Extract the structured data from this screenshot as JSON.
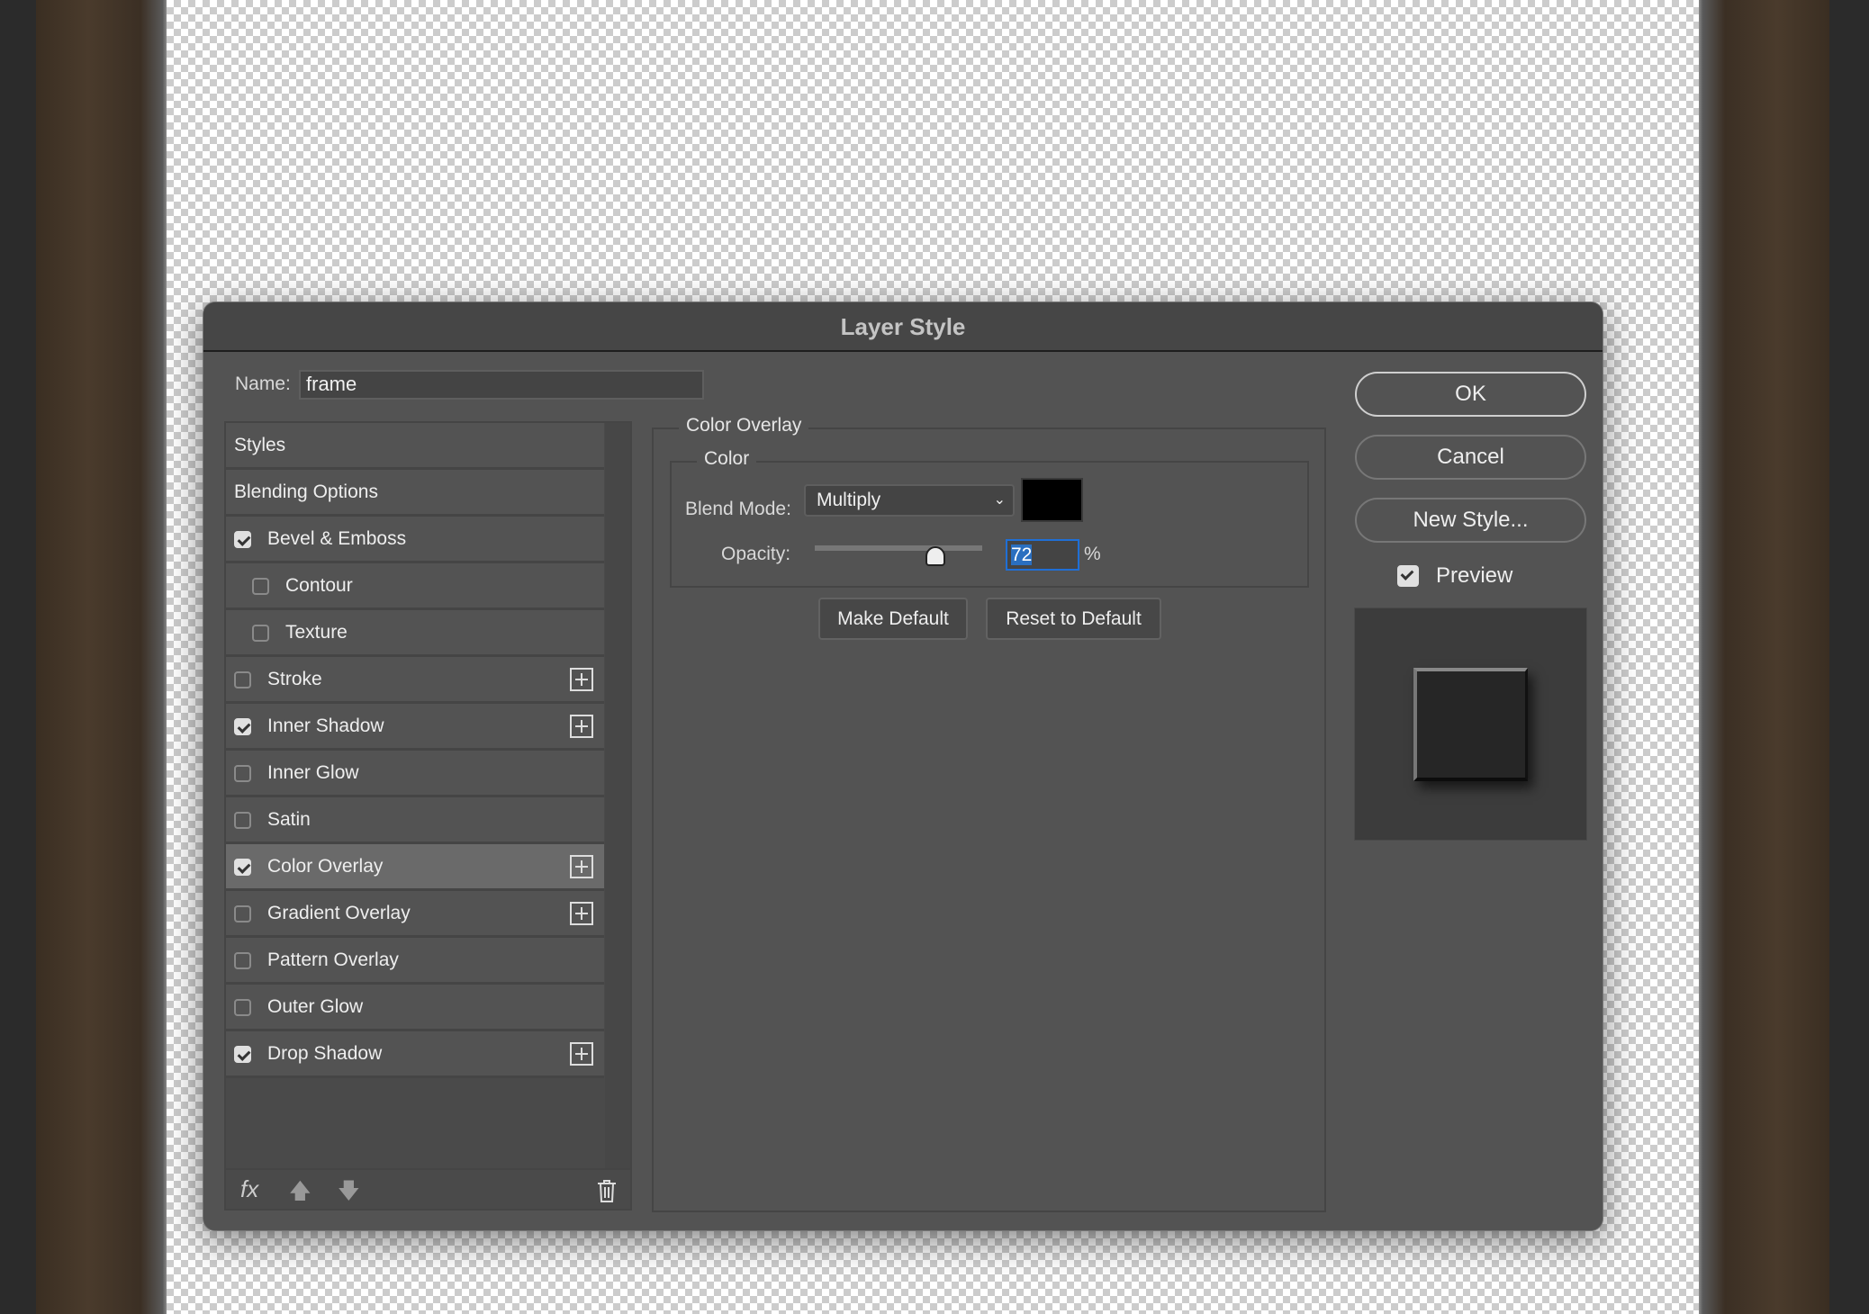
{
  "dialog": {
    "title": "Layer Style"
  },
  "name": {
    "label": "Name:",
    "value": "frame"
  },
  "list": {
    "items": [
      {
        "label": "Styles",
        "checkbox": null,
        "indent": 0,
        "plus": false,
        "selected": false
      },
      {
        "label": "Blending Options",
        "checkbox": null,
        "indent": 0,
        "plus": false,
        "selected": false
      },
      {
        "label": "Bevel & Emboss",
        "checkbox": true,
        "indent": 0,
        "plus": false,
        "selected": false
      },
      {
        "label": "Contour",
        "checkbox": false,
        "indent": 1,
        "plus": false,
        "selected": false
      },
      {
        "label": "Texture",
        "checkbox": false,
        "indent": 1,
        "plus": false,
        "selected": false
      },
      {
        "label": "Stroke",
        "checkbox": false,
        "indent": 0,
        "plus": true,
        "selected": false
      },
      {
        "label": "Inner Shadow",
        "checkbox": true,
        "indent": 0,
        "plus": true,
        "selected": false
      },
      {
        "label": "Inner Glow",
        "checkbox": false,
        "indent": 0,
        "plus": false,
        "selected": false
      },
      {
        "label": "Satin",
        "checkbox": false,
        "indent": 0,
        "plus": false,
        "selected": false
      },
      {
        "label": "Color Overlay",
        "checkbox": true,
        "indent": 0,
        "plus": true,
        "selected": true
      },
      {
        "label": "Gradient Overlay",
        "checkbox": false,
        "indent": 0,
        "plus": true,
        "selected": false
      },
      {
        "label": "Pattern Overlay",
        "checkbox": false,
        "indent": 0,
        "plus": false,
        "selected": false
      },
      {
        "label": "Outer Glow",
        "checkbox": false,
        "indent": 0,
        "plus": false,
        "selected": false
      },
      {
        "label": "Drop Shadow",
        "checkbox": true,
        "indent": 0,
        "plus": true,
        "selected": false
      }
    ],
    "toolbar": {
      "fx_label": "fx",
      "icons": [
        "fx-icon",
        "move-up-icon",
        "move-down-icon",
        "trash-icon"
      ]
    }
  },
  "panel": {
    "section_title": "Color Overlay",
    "group_title": "Color",
    "blend_mode_label": "Blend Mode:",
    "blend_mode_value": "Multiply",
    "color_swatch": "#000000",
    "opacity_label": "Opacity:",
    "opacity_value": "72",
    "opacity_unit": "%",
    "opacity_fraction": 0.72,
    "make_default": "Make Default",
    "reset_default": "Reset to Default"
  },
  "actions": {
    "ok": "OK",
    "cancel": "Cancel",
    "new_style": "New Style...",
    "preview_label": "Preview",
    "preview_checked": true
  },
  "colors": {
    "accent": "#1f6fd6",
    "dialog_bg": "#535353"
  }
}
